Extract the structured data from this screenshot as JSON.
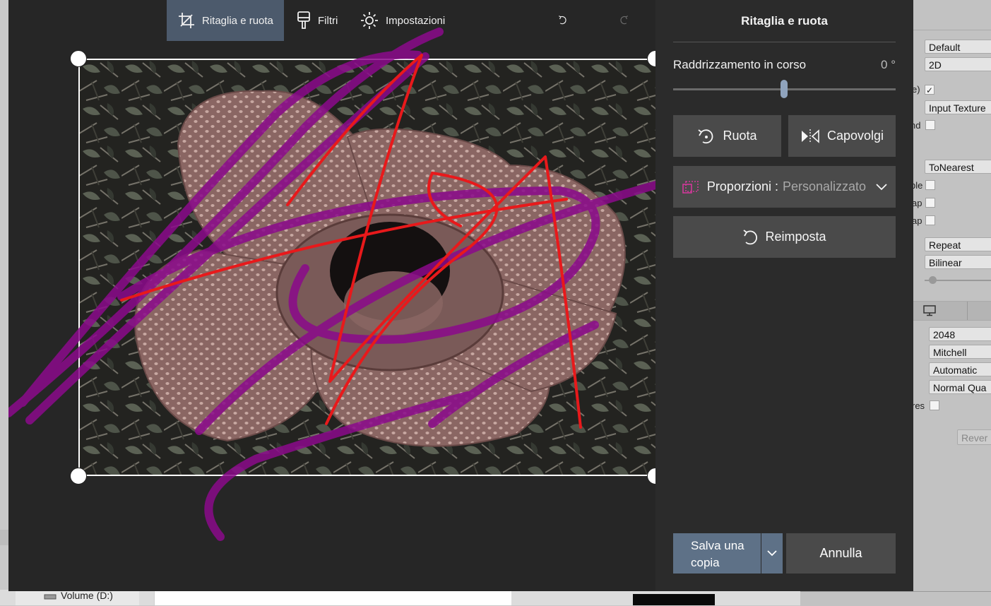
{
  "toolbar": {
    "crop_label": "Ritaglia e ruota",
    "filters_label": "Filtri",
    "settings_label": "Impostazioni"
  },
  "panel": {
    "title": "Ritaglia e ruota",
    "straighten_label": "Raddrizzamento in corso",
    "straighten_value": "0 °",
    "rotate_label": "Ruota",
    "flip_label": "Capovolgi",
    "aspect_label": "Proporzioni :",
    "aspect_value": "Personalizzato",
    "reset_label": "Reimposta",
    "save_label": "Salva una copia",
    "cancel_label": "Annulla"
  },
  "background_app": {
    "fields": [
      "Default",
      "2D",
      "Input Texture",
      "ToNearest",
      "Repeat",
      "Bilinear",
      "2048",
      "Mitchell",
      "Automatic",
      "Normal Qua"
    ],
    "labels": [
      "e)",
      "nd",
      "ble",
      "ap",
      "ap",
      "res"
    ],
    "revert_label": "Rever",
    "drive_label": "Volume (D:)"
  },
  "colors": {
    "accent": "#5e7187",
    "active_tab": "#4c5a6c",
    "ink_magenta": "#8b0a8b",
    "ink_red": "#e8191b"
  }
}
